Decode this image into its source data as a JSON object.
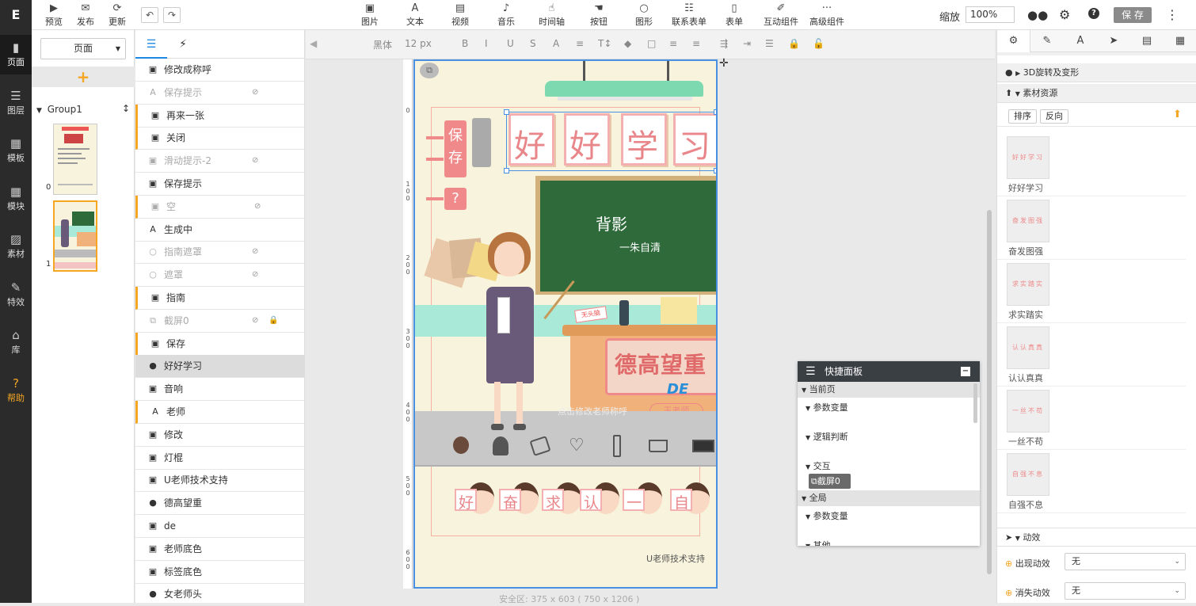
{
  "app": {
    "logo": "E"
  },
  "topbar": {
    "left_buttons": [
      {
        "icon": "play-icon",
        "glyph": "▶",
        "label": "预览"
      },
      {
        "icon": "wechat-icon",
        "glyph": "✉",
        "label": "发布"
      },
      {
        "icon": "refresh-icon",
        "glyph": "⟳",
        "label": "更新"
      }
    ],
    "undo": "↶",
    "redo": "↷",
    "components": [
      {
        "icon": "image-icon",
        "glyph": "▣",
        "label": "图片"
      },
      {
        "icon": "text-icon",
        "glyph": "A",
        "label": "文本"
      },
      {
        "icon": "video-icon",
        "glyph": "▤",
        "label": "视频"
      },
      {
        "icon": "music-icon",
        "glyph": "♪",
        "label": "音乐"
      },
      {
        "icon": "timeline-icon",
        "glyph": "☝",
        "label": "时间轴"
      },
      {
        "icon": "button-icon",
        "glyph": "☚",
        "label": "按钮"
      },
      {
        "icon": "shape-icon",
        "glyph": "○",
        "label": "图形"
      },
      {
        "icon": "contact-form-icon",
        "glyph": "☷",
        "label": "联系表单"
      },
      {
        "icon": "form-icon",
        "glyph": "▯",
        "label": "表单"
      },
      {
        "icon": "interactive-icon",
        "glyph": "✐",
        "label": "互动组件"
      },
      {
        "icon": "more-icon",
        "glyph": "···",
        "label": "高级组件"
      }
    ],
    "zoom_label": "缩放",
    "zoom_value": "100%",
    "save_label": "保 存",
    "right_icons": [
      "users-icon",
      "settings-icon",
      "help-icon"
    ],
    "menu_glyph": "⋮"
  },
  "leftnav": [
    {
      "icon": "page-icon",
      "glyph": "▮",
      "label": "页面"
    },
    {
      "icon": "layers-icon",
      "glyph": "☰",
      "label": "图层"
    },
    {
      "icon": "template-icon",
      "glyph": "▦",
      "label": "模板"
    },
    {
      "icon": "module-icon",
      "glyph": "▦",
      "label": "模块"
    },
    {
      "icon": "material-icon",
      "glyph": "▨",
      "label": "素材"
    },
    {
      "icon": "effects-icon",
      "glyph": "✎",
      "label": "特效"
    },
    {
      "icon": "library-icon",
      "glyph": "⌂",
      "label": "库"
    },
    {
      "icon": "help-circle-icon",
      "glyph": "?",
      "label": "帮助"
    }
  ],
  "pages": {
    "select_label": "页面",
    "add_glyph": "+",
    "group_name": "Group1",
    "thumb_indexes": [
      "0",
      "1"
    ]
  },
  "layers": [
    {
      "name": "修改成称呼",
      "type": "image",
      "hidden": false,
      "marked": false
    },
    {
      "name": "保存提示",
      "type": "text",
      "hidden": true,
      "marked": false
    },
    {
      "name": "再来一张",
      "type": "image",
      "hidden": false,
      "marked": true
    },
    {
      "name": "关闭",
      "type": "image",
      "hidden": false,
      "marked": true
    },
    {
      "name": "滑动提示-2",
      "type": "image",
      "hidden": true,
      "marked": false
    },
    {
      "name": "保存提示",
      "type": "image",
      "hidden": false,
      "marked": false
    },
    {
      "name": "空",
      "type": "image",
      "hidden": true,
      "marked": true
    },
    {
      "name": "生成中",
      "type": "text",
      "hidden": false,
      "marked": false
    },
    {
      "name": "指南遮罩",
      "type": "shape",
      "hidden": true,
      "marked": false
    },
    {
      "name": "遮罩",
      "type": "shape",
      "hidden": true,
      "marked": false
    },
    {
      "name": "指南",
      "type": "image",
      "hidden": false,
      "marked": true
    },
    {
      "name": "截屏0",
      "type": "screenshot",
      "hidden": true,
      "locked": true,
      "marked": false
    },
    {
      "name": "保存",
      "type": "image",
      "hidden": false,
      "marked": true
    },
    {
      "name": "好好学习",
      "type": "group",
      "hidden": false,
      "marked": false,
      "selected": true
    },
    {
      "name": "音响",
      "type": "image",
      "hidden": false,
      "marked": false
    },
    {
      "name": "老师",
      "type": "text",
      "hidden": false,
      "marked": true
    },
    {
      "name": "修改",
      "type": "image",
      "hidden": false,
      "marked": false
    },
    {
      "name": "灯棍",
      "type": "image",
      "hidden": false,
      "marked": false
    },
    {
      "name": "U老师技术支持",
      "type": "image",
      "hidden": false,
      "marked": false
    },
    {
      "name": "德高望重",
      "type": "group",
      "hidden": false,
      "marked": false
    },
    {
      "name": "de",
      "type": "image",
      "hidden": false,
      "marked": false
    },
    {
      "name": "老师底色",
      "type": "image",
      "hidden": false,
      "marked": false
    },
    {
      "name": "标签底色",
      "type": "image",
      "hidden": false,
      "marked": false
    },
    {
      "name": "女老师头",
      "type": "group",
      "hidden": false,
      "marked": false
    }
  ],
  "fmtbar": {
    "font": "黑体",
    "size": "12 px",
    "tools": [
      "B",
      "I",
      "U",
      "S",
      "A",
      "≡",
      "T↕",
      "◆",
      "□",
      "≡",
      "≡",
      "⇶",
      "⇥",
      "☰",
      "🔒",
      "🔓"
    ]
  },
  "canvas": {
    "ruler_marks": [
      "0",
      "100",
      "200",
      "300",
      "400",
      "500",
      "600"
    ],
    "safe_area": "安全区: 375 x 603 ( 750 x 1206 )",
    "title_chars": [
      "好",
      "好",
      "学",
      "习"
    ],
    "side_chars": [
      "保",
      "存",
      "?"
    ],
    "board_text1": "背影",
    "board_text2": "一朱自清",
    "plaque": "德高望重",
    "plaque_sign": "王老师",
    "plaque_de": "DE",
    "hint": "点击修改老师称呼",
    "bottom_chars": [
      "好",
      "奋",
      "求",
      "认",
      "一",
      "自"
    ],
    "support": "U老师技术支持",
    "badge": "无头脑"
  },
  "quick_panel": {
    "title": "快捷面板",
    "current_page": "当前页",
    "params": "参数变量",
    "logic": "逻辑判断",
    "interact": "交互",
    "chip": "截屏0",
    "global": "全局",
    "global_params": "参数变量",
    "other": "其他"
  },
  "rpanel": {
    "tabs": [
      "gear-icon",
      "brush-icon",
      "font-icon",
      "send-icon",
      "document-icon",
      "table-icon"
    ],
    "tab_glyphs": [
      "⚙",
      "✎",
      "A",
      "➤",
      "▤",
      "▦"
    ],
    "sec_3d": "3D旋转及变形",
    "sec_assets": "素材资源",
    "sort": "排序",
    "reverse": "反向",
    "assets": [
      {
        "name": "好好学习",
        "preview": "好好学习"
      },
      {
        "name": "奋发图强",
        "preview": "奋发图强"
      },
      {
        "name": "求实踏实",
        "preview": "求实踏实"
      },
      {
        "name": "认认真真",
        "preview": "认认真真"
      },
      {
        "name": "一丝不苟",
        "preview": "一丝不苟"
      },
      {
        "name": "自强不息",
        "preview": "自强不息"
      }
    ],
    "sec_anim": "动效",
    "appear_label": "出现动效",
    "appear_value": "无",
    "disappear_label": "消失动效",
    "disappear_value": "无"
  },
  "colors": {
    "accent": "#f5a623",
    "brand_dark": "#2b2b2b",
    "selection": "#4a90e2",
    "board": "#2f6b3a",
    "mint": "#a8ead7"
  }
}
